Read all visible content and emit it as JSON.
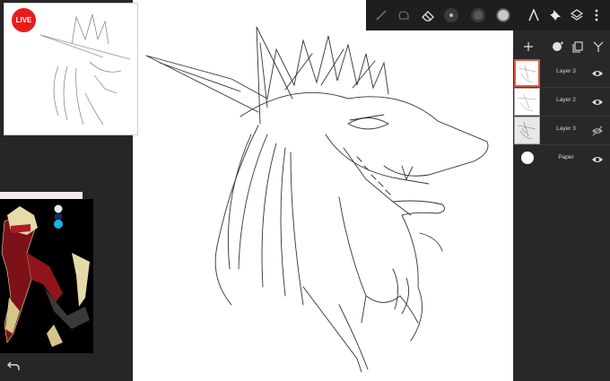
{
  "badge": {
    "live_label": "LIVE"
  },
  "toolbar": {
    "tools": [
      "brush-icon",
      "smudge-icon",
      "eraser-icon",
      "brush-size-icon",
      "opacity-icon",
      "color-icon"
    ],
    "right": [
      "ruler-icon",
      "pin-icon",
      "layers-icon",
      "more-icon"
    ]
  },
  "layers_panel": {
    "actions": [
      "add-icon",
      "add-layer-icon",
      "duplicate-icon",
      "merge-icon"
    ],
    "layers": [
      {
        "name": "Layer 3",
        "visible": true,
        "active": true
      },
      {
        "name": "Layer 2",
        "visible": true,
        "active": false
      },
      {
        "name": "Layer 3",
        "visible": false,
        "active": false
      },
      {
        "name": "Paper",
        "visible": true,
        "active": false
      }
    ]
  },
  "colors": {
    "accent": "#e4573d",
    "live": "#e81c1c",
    "swatch_top": "#e6edf1",
    "swatch_mid": "#1a2a5a",
    "swatch_bottom": "#19b4e3"
  }
}
